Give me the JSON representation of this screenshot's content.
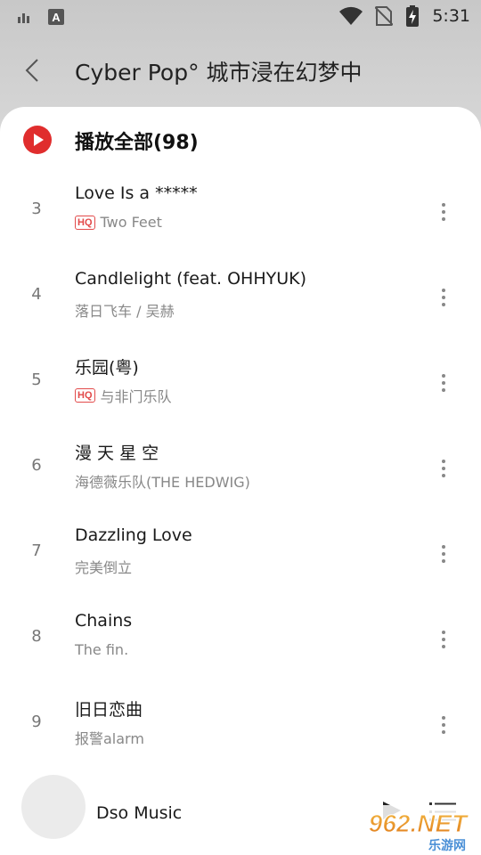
{
  "status_bar": {
    "time": "5:31",
    "left_icons": [
      "signal-bars-icon",
      "keyboard-a-icon"
    ],
    "right_icons": [
      "wifi-icon",
      "no-sim-icon",
      "battery-charging-icon"
    ]
  },
  "header": {
    "title": "Cyber Pop° 城市浸在幻梦中",
    "back_icon": "chevron-left-icon"
  },
  "play_all": {
    "label": "播放全部(98)",
    "icon": "play-circle-icon",
    "accent_color": "#e02d2d"
  },
  "tracks": [
    {
      "number": "3",
      "title": "Love Is a *****",
      "hq": "HQ",
      "artist": "Two Feet"
    },
    {
      "number": "4",
      "title": "Candlelight (feat. OHHYUK)",
      "hq": "",
      "artist": "落日飞车 / 吴赫"
    },
    {
      "number": "5",
      "title": "乐园(粤)",
      "hq": "HQ",
      "artist": "与非门乐队"
    },
    {
      "number": "6",
      "title": "漫 天 星 空",
      "hq": "",
      "artist": "海德薇乐队(THE HEDWIG)"
    },
    {
      "number": "7",
      "title": "Dazzling Love",
      "hq": "",
      "artist": "完美倒立"
    },
    {
      "number": "8",
      "title": "Chains",
      "hq": "",
      "artist": "The fin."
    },
    {
      "number": "9",
      "title": "旧日恋曲",
      "hq": "",
      "artist": "报警alarm"
    }
  ],
  "player": {
    "title": "Dso Music",
    "play_icon": "play-icon",
    "queue_icon": "playlist-icon"
  },
  "watermark": {
    "brand": "962.NET",
    "subtitle": "乐游网"
  }
}
